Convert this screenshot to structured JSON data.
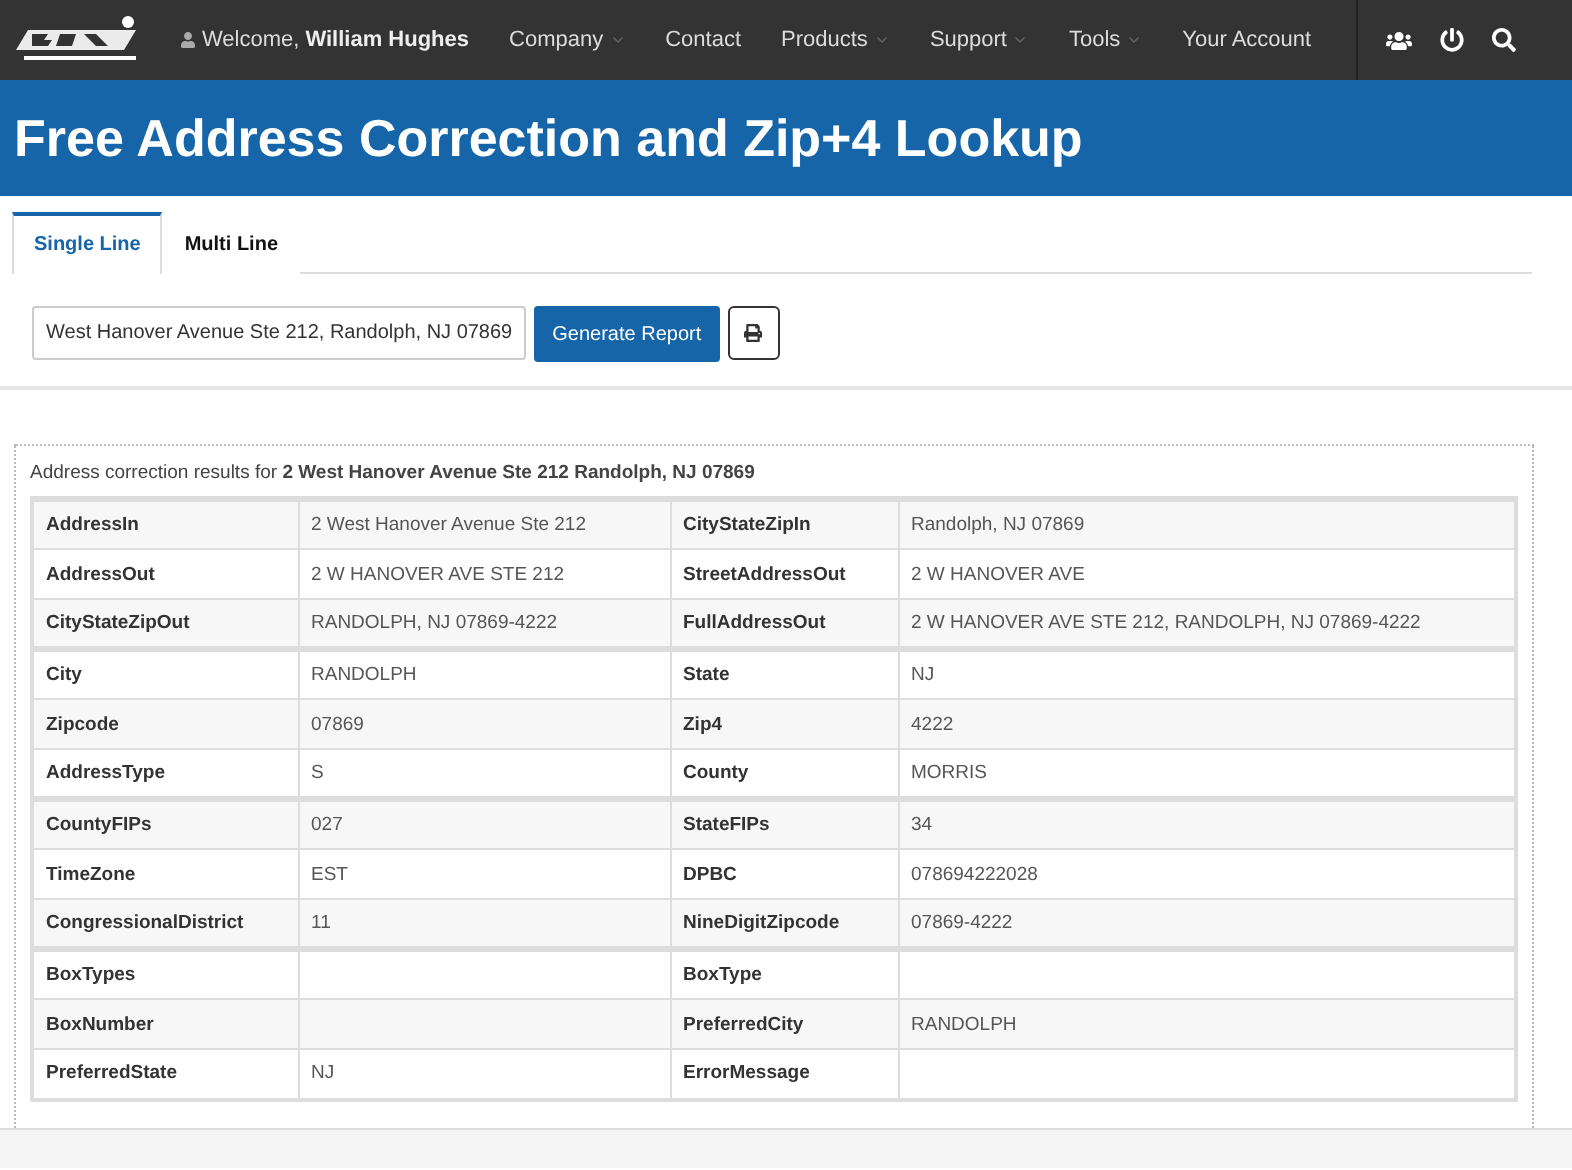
{
  "nav": {
    "welcome": "Welcome,",
    "user": "William Hughes",
    "items": [
      {
        "label": "Company",
        "dropdown": true
      },
      {
        "label": "Contact",
        "dropdown": false
      },
      {
        "label": "Products",
        "dropdown": true
      },
      {
        "label": "Support",
        "dropdown": true
      },
      {
        "label": "Tools",
        "dropdown": true
      },
      {
        "label": "Your Account",
        "dropdown": false
      }
    ]
  },
  "page_title": "Free Address Correction and Zip+4 Lookup",
  "tabs": [
    {
      "label": "Single Line",
      "selected": true
    },
    {
      "label": "Multi Line",
      "selected": false
    }
  ],
  "address_field": {
    "value": "West Hanover Avenue Ste 212, Randolph, NJ 07869"
  },
  "generate_button": "Generate Report",
  "results_caption": "Address correction results for **2 West Hanover Avenue Ste 212 Randolph, NJ 07869**",
  "table_groups": [
    [
      {
        "label_1": "AddressIn",
        "value_1": "2 West Hanover Avenue Ste 212",
        "label_2": "CityStateZipIn",
        "value_2": "Randolph, NJ 07869"
      },
      {
        "label_1": "AddressOut",
        "value_1": "2 W HANOVER AVE STE 212",
        "label_2": "StreetAddressOut",
        "value_2": "2 W HANOVER AVE"
      },
      {
        "label_1": "CityStateZipOut",
        "value_1": "RANDOLPH, NJ 07869-4222",
        "label_2": "FullAddressOut",
        "value_2": "2 W HANOVER AVE STE 212, RANDOLPH, NJ 07869-4222"
      }
    ],
    [
      {
        "label_1": "City",
        "value_1": "RANDOLPH",
        "label_2": "State",
        "value_2": "NJ"
      },
      {
        "label_1": "Zipcode",
        "value_1": "07869",
        "label_2": "Zip4",
        "value_2": "4222"
      },
      {
        "label_1": "AddressType",
        "value_1": "S",
        "label_2": "County",
        "value_2": "MORRIS"
      }
    ],
    [
      {
        "label_1": "CountyFIPs",
        "value_1": "027",
        "label_2": "StateFIPs",
        "value_2": "34"
      },
      {
        "label_1": "TimeZone",
        "value_1": "EST",
        "label_2": "DPBC",
        "value_2": "078694222028"
      },
      {
        "label_1": "CongressionalDistrict",
        "value_1": "11",
        "label_2": "NineDigitZipcode",
        "value_2": "07869-4222"
      }
    ],
    [
      {
        "label_1": "BoxTypes",
        "label_2": "BoxType"
      },
      {
        "label_1": "BoxNumber",
        "label_2": "PreferredCity",
        "value_2": "RANDOLPH"
      },
      {
        "label_1": "PreferredState",
        "value_1": "NJ",
        "label_2": "ErrorMessage"
      }
    ]
  ]
}
